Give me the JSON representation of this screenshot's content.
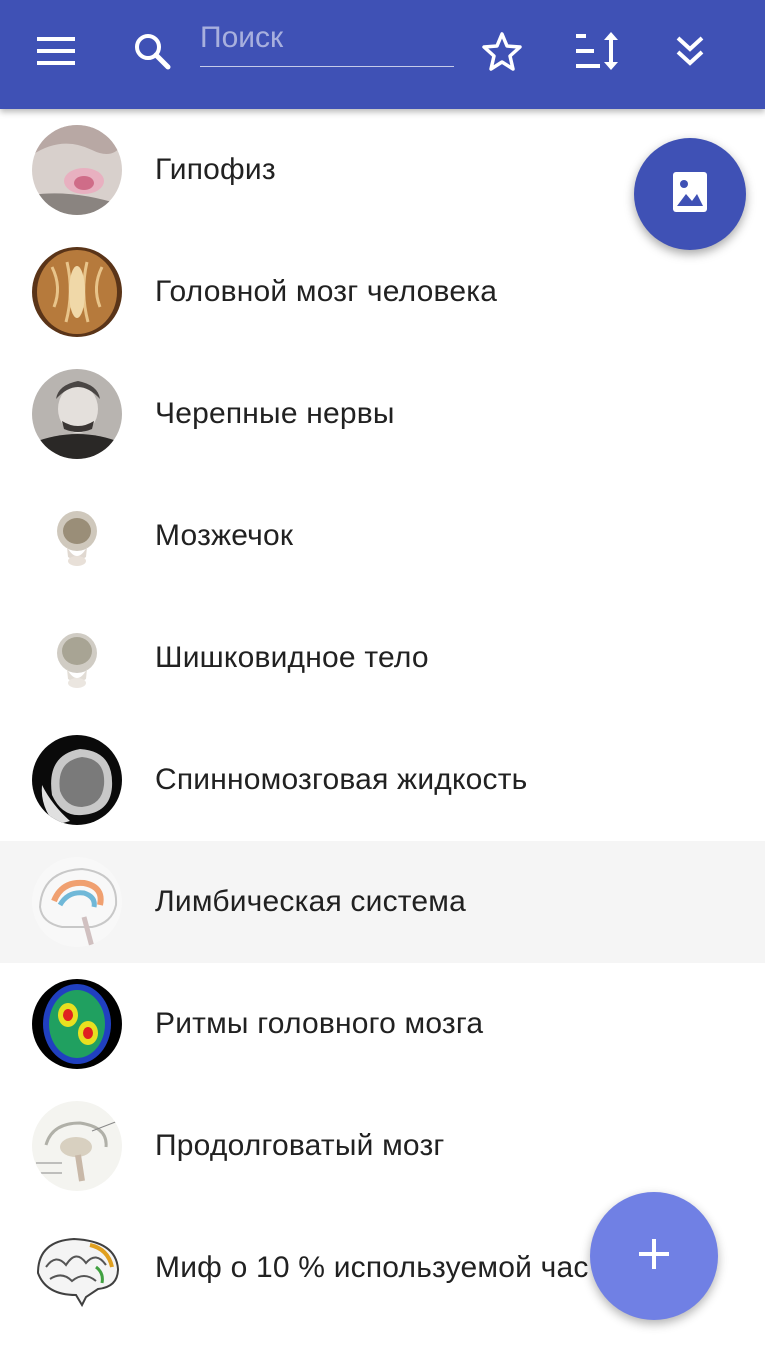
{
  "toolbar": {
    "search_placeholder": "Поиск",
    "search_value": ""
  },
  "items": [
    {
      "label": "Гипофиз",
      "icon": "pituitary-image"
    },
    {
      "label": "Головной мозг человека",
      "icon": "brain-section-image"
    },
    {
      "label": "Черепные нервы",
      "icon": "portrait-image"
    },
    {
      "label": "Мозжечок",
      "icon": "skull-image"
    },
    {
      "label": "Шишковидное тело",
      "icon": "skull-image"
    },
    {
      "label": "Спинномозговая жидкость",
      "icon": "mri-image"
    },
    {
      "label": "Лимбическая система",
      "icon": "limbic-diagram-image",
      "selected": true
    },
    {
      "label": "Ритмы головного мозга",
      "icon": "brain-scan-image"
    },
    {
      "label": "Продолговатый мозг",
      "icon": "medulla-diagram-image"
    },
    {
      "label": "Миф о 10 % используемой час",
      "icon": "brain-sketch-image"
    }
  ],
  "colors": {
    "primary": "#3f51b5",
    "accent_fab": "#7080e4",
    "selected_row": "#f5f5f5"
  },
  "fabs": {
    "photo": "image-icon",
    "add": "plus-icon"
  }
}
